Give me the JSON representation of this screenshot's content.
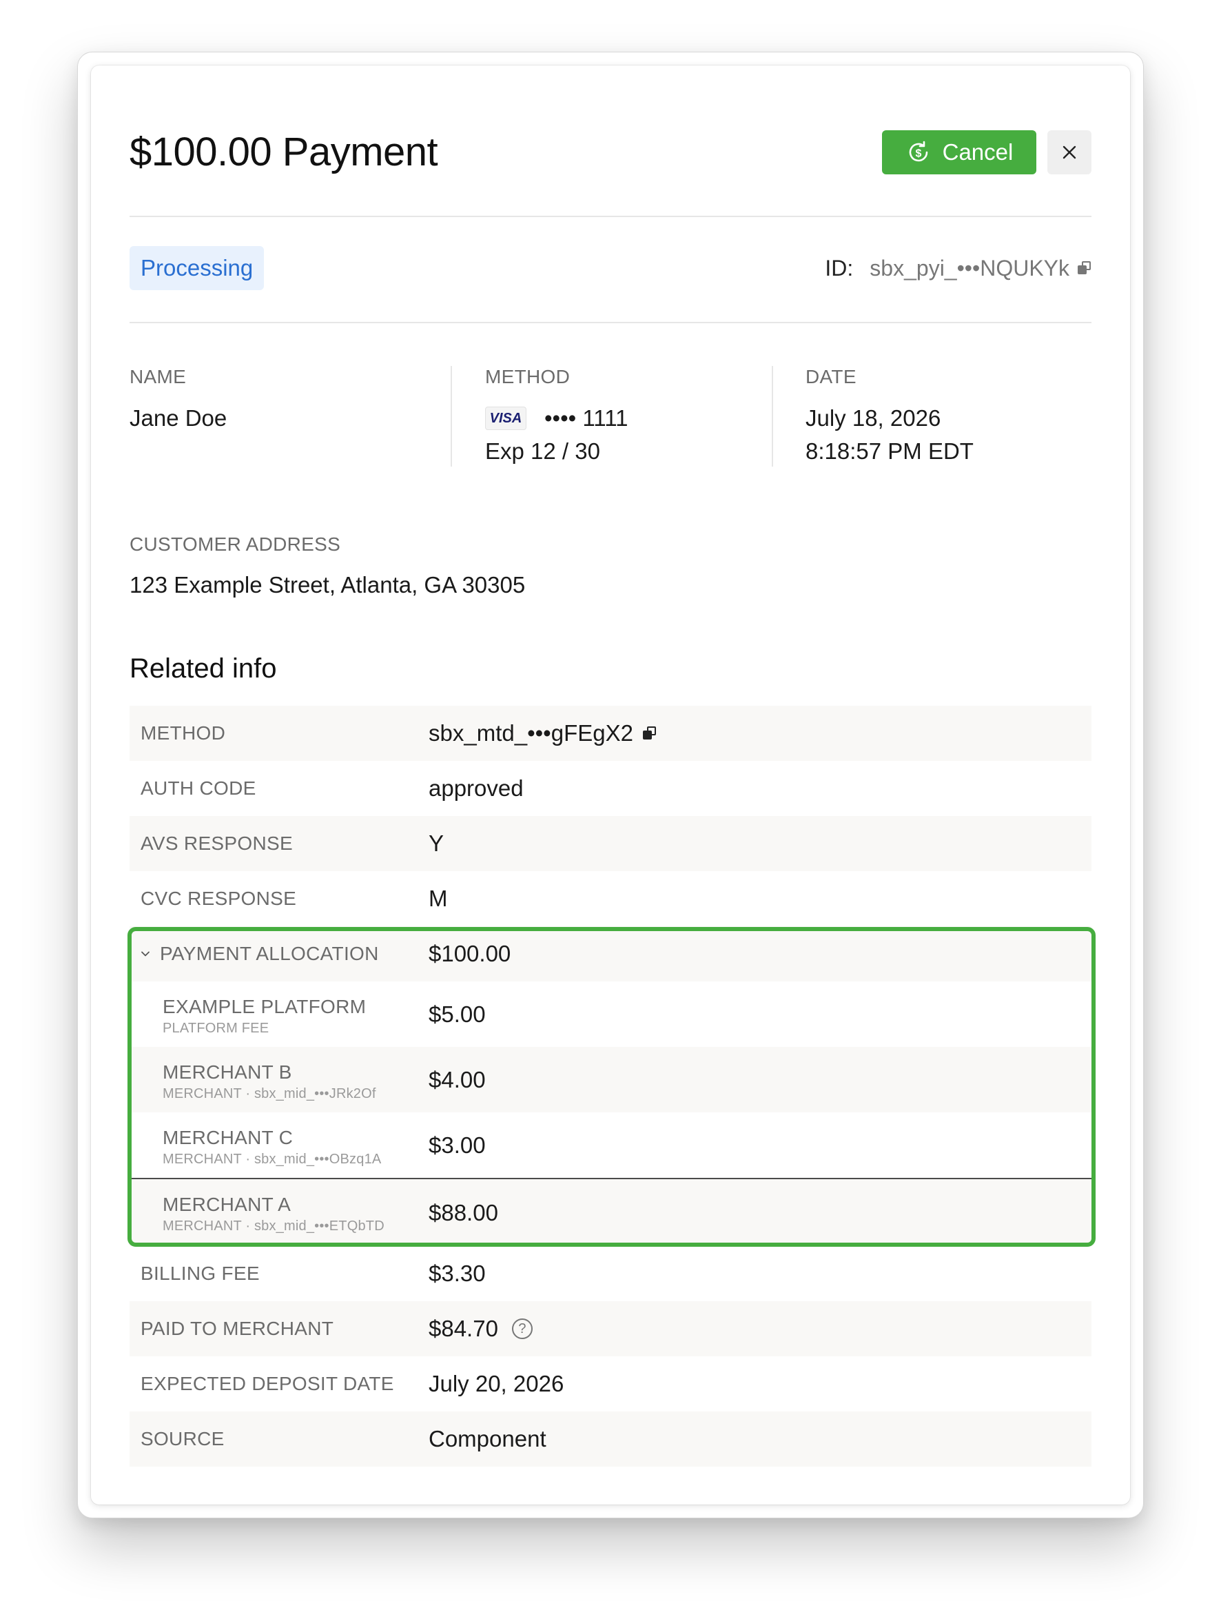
{
  "header": {
    "title": "$100.00 Payment",
    "cancel_label": "Cancel",
    "accent_color": "#46ad3f"
  },
  "status": {
    "badge": "Processing",
    "id_label": "ID:",
    "id_value": "sbx_pyi_•••NQUKYk"
  },
  "details": {
    "name": {
      "label": "NAME",
      "value": "Jane Doe"
    },
    "method": {
      "label": "METHOD",
      "brand": "VISA",
      "masked": "•••• 1111",
      "expiry": "Exp 12 / 30"
    },
    "date": {
      "label": "DATE",
      "date": "July 18, 2026",
      "time": "8:18:57 PM EDT"
    },
    "address": {
      "label": "CUSTOMER ADDRESS",
      "value": "123 Example Street, Atlanta, GA 30305"
    }
  },
  "related": {
    "title": "Related info",
    "method": {
      "label": "METHOD",
      "value": "sbx_mtd_•••gFEgX2"
    },
    "auth_code": {
      "label": "AUTH CODE",
      "value": "approved"
    },
    "avs": {
      "label": "AVS RESPONSE",
      "value": "Y"
    },
    "cvc": {
      "label": "CVC RESPONSE",
      "value": "M"
    },
    "allocation": {
      "label": "PAYMENT ALLOCATION",
      "value": "$100.00",
      "items": [
        {
          "name": "EXAMPLE PLATFORM",
          "sub": "PLATFORM FEE",
          "amount": "$5.00"
        },
        {
          "name": "MERCHANT B",
          "sub": "MERCHANT · sbx_mid_•••JRk2Of",
          "amount": "$4.00"
        },
        {
          "name": "MERCHANT C",
          "sub": "MERCHANT · sbx_mid_•••OBzq1A",
          "amount": "$3.00"
        },
        {
          "name": "MERCHANT A",
          "sub": "MERCHANT · sbx_mid_•••ETQbTD",
          "amount": "$88.00"
        }
      ]
    },
    "billing_fee": {
      "label": "BILLING FEE",
      "value": "$3.30"
    },
    "paid_to_merchant": {
      "label": "PAID TO MERCHANT",
      "value": "$84.70"
    },
    "deposit_date": {
      "label": "EXPECTED DEPOSIT DATE",
      "value": "July 20, 2026"
    },
    "source": {
      "label": "SOURCE",
      "value": "Component"
    }
  }
}
